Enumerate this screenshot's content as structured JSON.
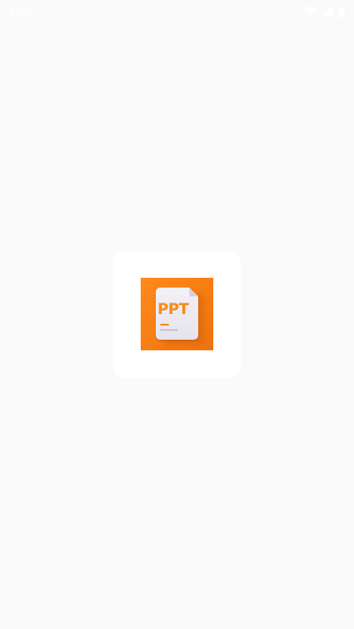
{
  "status_bar": {
    "time": "5:08",
    "icons": [
      "wifi-icon",
      "cellular-signal-icon",
      "battery-icon"
    ]
  },
  "splash": {
    "logo_text": "PPT",
    "logo_icon": "presentation-document-icon",
    "colors": {
      "background": "#fafafa",
      "card": "#ffffff",
      "logo_orange": "#f57c12",
      "document": "#eeecf2"
    }
  }
}
